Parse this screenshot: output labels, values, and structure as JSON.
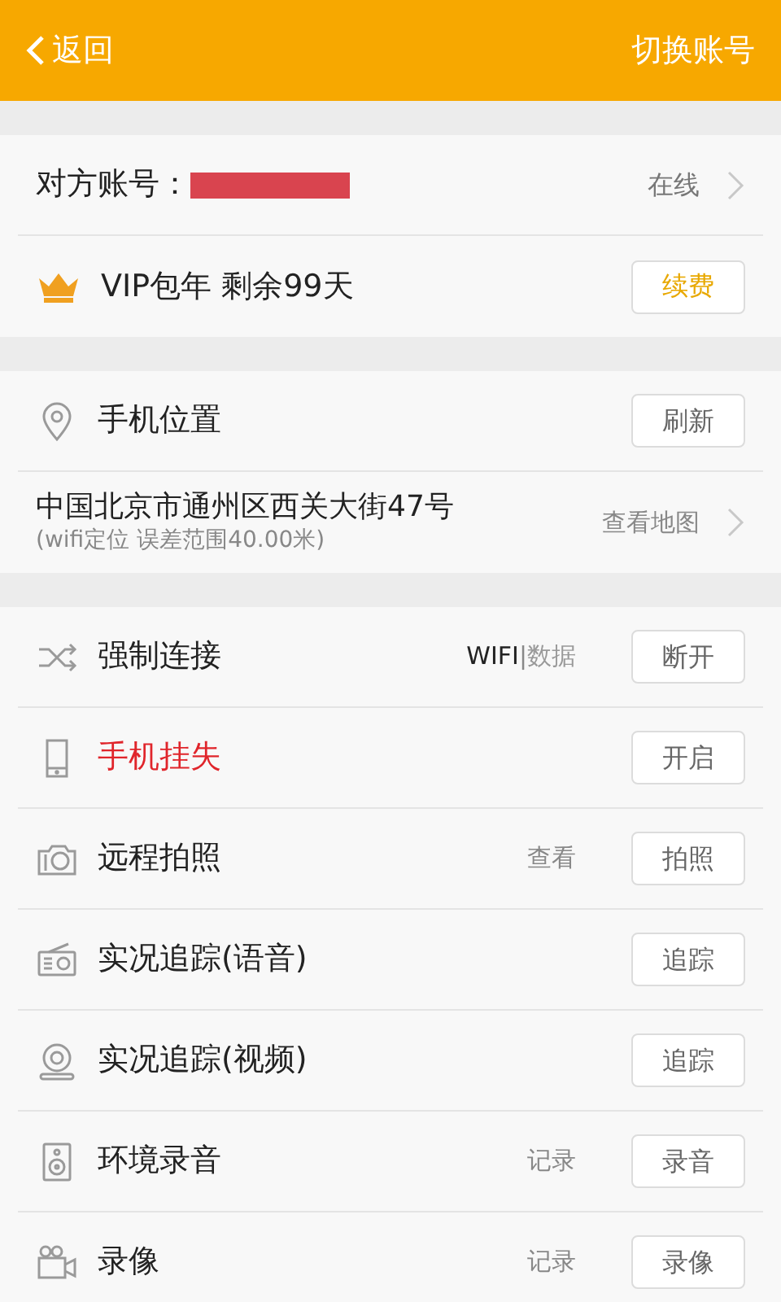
{
  "header": {
    "back": "返回",
    "action": "切换账号"
  },
  "account": {
    "label": "对方账号：",
    "redacted": true,
    "status": "在线"
  },
  "vip": {
    "text": "VIP包年 剩余99天",
    "button": "续费"
  },
  "location": {
    "title": "手机位置",
    "button": "刷新",
    "address": "中国北京市通州区西关大街47号",
    "note": "(wifi定位 误差范围40.00米)",
    "link": "查看地图"
  },
  "functions": [
    {
      "kind": "shuffle",
      "label": "强制连接",
      "alert": false,
      "modes": [
        {
          "label": "WIFI",
          "selected": true
        },
        {
          "label": "数据",
          "selected": false
        }
      ],
      "separator": "|",
      "button": "断开"
    },
    {
      "kind": "phone",
      "label": "手机挂失",
      "alert": true,
      "button": "开启"
    },
    {
      "kind": "camera",
      "label": "远程拍照",
      "alert": false,
      "side": "查看",
      "button": "拍照"
    },
    {
      "kind": "radio",
      "label": "实况追踪(语音)",
      "alert": false,
      "button": "追踪"
    },
    {
      "kind": "webcam",
      "label": "实况追踪(视频)",
      "alert": false,
      "button": "追踪"
    },
    {
      "kind": "speaker",
      "label": "环境录音",
      "alert": false,
      "side": "记录",
      "button": "录音"
    },
    {
      "kind": "video",
      "label": "录像",
      "alert": false,
      "side": "记录",
      "button": "录像"
    }
  ]
}
